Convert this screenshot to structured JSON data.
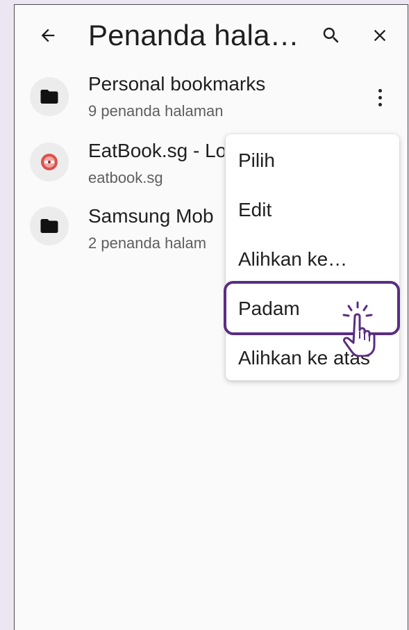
{
  "header": {
    "title": "Penanda hala…",
    "back_icon": "arrow-left-icon",
    "search_icon": "search-icon",
    "close_icon": "close-icon"
  },
  "bookmarks": [
    {
      "title": "Personal bookmarks",
      "subtitle": "9 penanda halaman",
      "icon": "folder-icon"
    },
    {
      "title": "EatBook.sg - Lo",
      "subtitle": "eatbook.sg",
      "icon": "favicon-eatbook"
    },
    {
      "title": "Samsung Mob",
      "subtitle": "2 penanda halam",
      "icon": "folder-icon"
    }
  ],
  "menu": {
    "items": [
      "Pilih",
      "Edit",
      "Alihkan ke…",
      "Padam",
      "Alihkan ke atas"
    ],
    "highlighted": "Padam"
  },
  "colors": {
    "highlight_border": "#5a2d82",
    "background": "#ece6f3",
    "favicon_red": "#d9534f"
  }
}
